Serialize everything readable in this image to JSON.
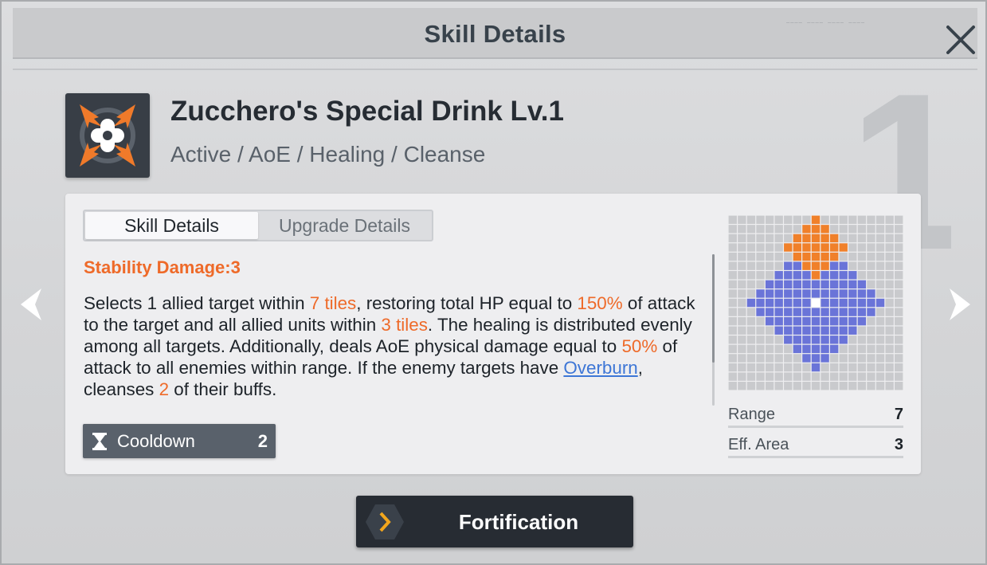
{
  "header": {
    "title": "Skill Details"
  },
  "skill": {
    "name": "Zucchero's Special Drink Lv.1",
    "tags": "Active / AoE / Healing / Cleanse",
    "icon": "healing-cross-burst-icon"
  },
  "tabs": [
    {
      "label": "Skill Details",
      "active": true
    },
    {
      "label": "Upgrade Details",
      "active": false
    }
  ],
  "stability": "Stability Damage:3",
  "description": {
    "p1": "Selects 1 allied target within ",
    "h1": "7 tiles",
    "p2": ", restoring total HP equal to ",
    "h2": "150%",
    "p3": " of attack to the target and all allied units within ",
    "h3": "3 tiles",
    "p4": ". The healing is distributed evenly among all targets. Additionally, deals AoE physical damage equal to ",
    "h4": "50%",
    "p5": " of attack to all enemies within range. If the enemy targets have ",
    "link": "Overburn",
    "p6": ", cleanses ",
    "h5": "2",
    "p7": " of their buffs."
  },
  "cooldown": {
    "label": "Cooldown",
    "value": "2",
    "icon": "hourglass-icon"
  },
  "stats": [
    {
      "label": "Range",
      "value": "7"
    },
    {
      "label": "Eff. Area",
      "value": "3"
    }
  ],
  "range_grid": {
    "size": 19,
    "center": [
      9,
      9
    ],
    "range_radius": 7,
    "area_radius": 3,
    "area_center": [
      9,
      3
    ],
    "colors": {
      "empty": "#c9cacd",
      "range": "#6a74d8",
      "area": "#f0802a",
      "center": "#ffffff"
    }
  },
  "background_numeral": "1",
  "footer_button": {
    "label": "Fortification",
    "icon": "chevron-right-hex-icon"
  },
  "colors": {
    "accent": "#ee6a29",
    "link": "#3d76d6",
    "panel": "#eeeef0"
  }
}
